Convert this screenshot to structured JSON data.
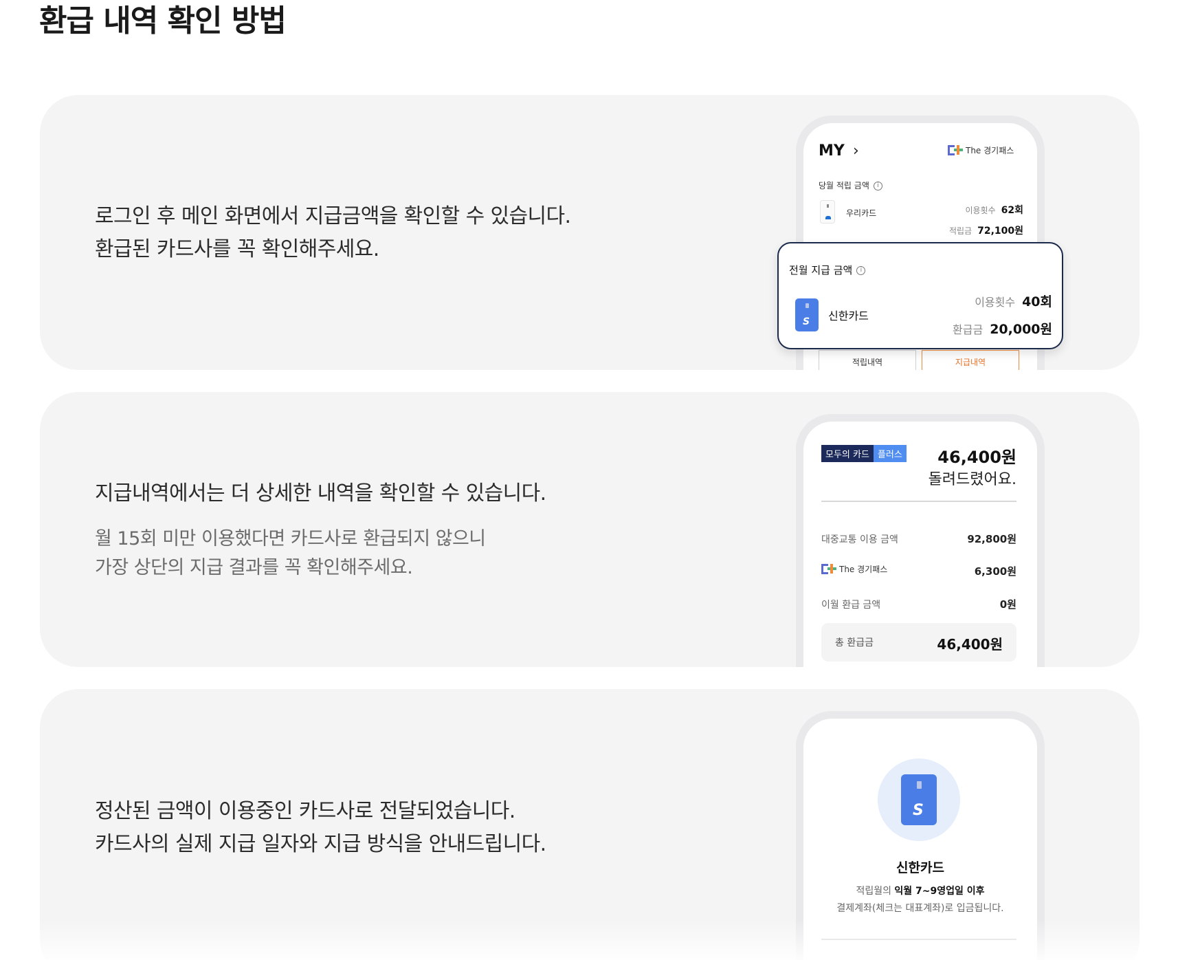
{
  "page": {
    "title": "환급 내역 확인 방법"
  },
  "section1": {
    "lines": [
      "로그인 후 메인 화면에서 지급금액을 확인할 수 있습니다.",
      "환급된 카드사를 꼭 확인해주세요."
    ],
    "phone": {
      "my_label": "MY",
      "chevron": "chevron-right-icon",
      "logo_text": "The 경기패스",
      "current_label": "당월 적립 금액",
      "card_name": "우리카드",
      "usage_label": "이용횟수",
      "usage_value": "62회",
      "accrual_label": "적립금",
      "accrual_value": "72,100원",
      "tab_history": "적립내역",
      "tab_payment": "지급내역"
    },
    "popup": {
      "title": "전월 지급 금액",
      "card_name": "신한카드",
      "usage_label": "이용횟수",
      "usage_value": "40회",
      "refund_label": "환급금",
      "refund_value": "20,000원"
    }
  },
  "section2": {
    "heading": "지급내역에서는 더 상세한 내역을 확인할 수 있습니다.",
    "sub_lines": [
      "월 15회 미만 이용했다면 카드사로 환급되지 않으니",
      "가장 상단의 지급 결과를 꼭 확인해주세요."
    ],
    "phone": {
      "badge_main": "모두의 카드",
      "badge_plus": "플러스",
      "amount": "46,400원",
      "amount_sub": "돌려드렸어요.",
      "rows": [
        {
          "label": "대중교통 이용 금액",
          "value": "92,800원"
        },
        {
          "label": "The 경기패스",
          "value": "6,300원"
        },
        {
          "label": "이월 환급 금액",
          "value": "0원"
        }
      ],
      "total_label": "총 환급금",
      "total_value": "46,400원"
    }
  },
  "section3": {
    "lines": [
      "정산된 금액이 이용중인 카드사로 전달되었습니다.",
      "카드사의 실제 지급 일자와 지급 방식을 안내드립니다."
    ],
    "phone": {
      "card_name": "신한카드",
      "line1_prefix": "적립월의 ",
      "line1_bold": "익월 7~9영업일 이후",
      "line2": "결제계좌(체크는 대표계좌)로 입금됩니다."
    }
  },
  "colors": {
    "section_bg": "#f4f4f4",
    "accent_orange": "#e8722a",
    "navy": "#1b2a4a",
    "card_blue": "#4a7ee6"
  }
}
